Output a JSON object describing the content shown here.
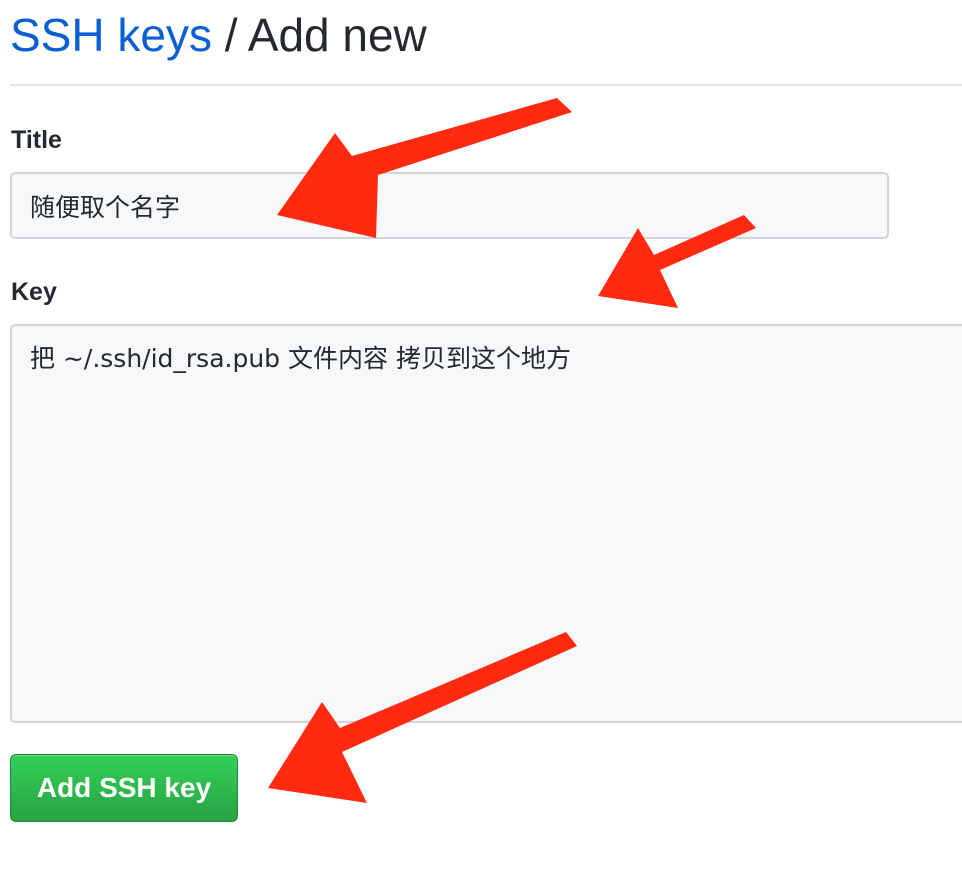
{
  "header": {
    "breadcrumb_link": "SSH keys",
    "separator": "/",
    "current": "Add new"
  },
  "form": {
    "title_label": "Title",
    "title_value": "随便取个名字",
    "key_label": "Key",
    "key_value": "把 ~/.ssh/id_rsa.pub 文件内容 拷贝到这个地方",
    "submit_label": "Add SSH key"
  },
  "annotations": {
    "arrow_color": "#ff2a10",
    "arrow_count": 3
  },
  "colors": {
    "link": "#0a5fd2",
    "button": "#28a745",
    "input_bg": "#f6f8fa"
  }
}
